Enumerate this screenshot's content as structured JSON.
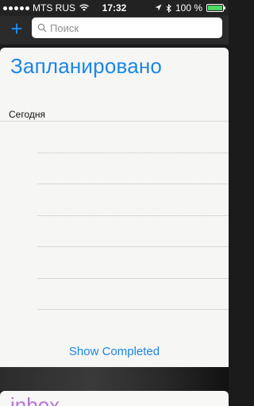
{
  "status_bar": {
    "carrier": "MTS RUS",
    "time": "17:32",
    "battery": "100 %",
    "battery_level": 1.0
  },
  "header": {
    "add_label": "+",
    "search_placeholder": "Поиск"
  },
  "list": {
    "title": "Запланировано",
    "section": "Сегодня",
    "show_completed": "Show Completed"
  },
  "next_list": {
    "title": "inbox"
  },
  "colors": {
    "accent": "#1a87e6",
    "next_list_color": "#b574d6",
    "battery_fill": "#4cd964"
  },
  "icons": [
    "signal-icon",
    "wifi-icon",
    "location-icon",
    "bluetooth-icon",
    "battery-icon",
    "search-icon",
    "add-icon"
  ]
}
